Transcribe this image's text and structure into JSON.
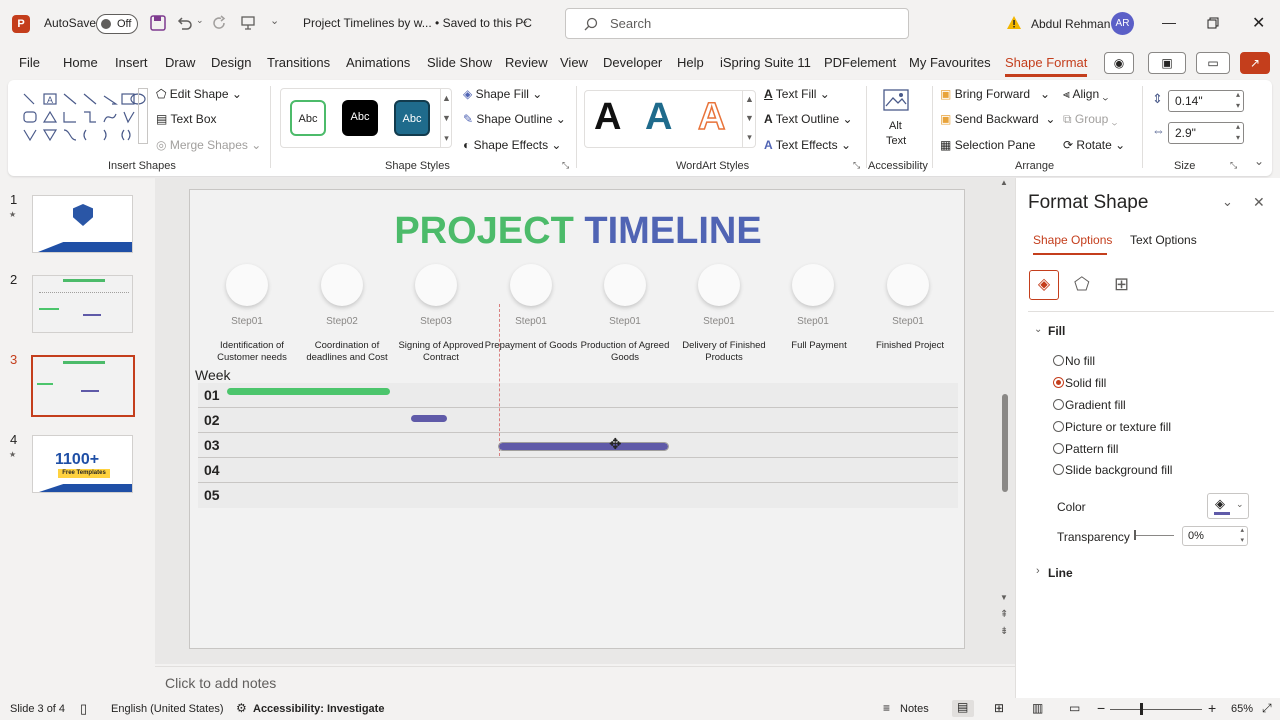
{
  "titlebar": {
    "autosave_label": "AutoSave",
    "autosave_state": "Off",
    "doc_title": "Project Timelines by w...  •  Saved to this PC",
    "search_placeholder": "Search",
    "user_name": "Abdul Rehman",
    "user_initials": "AR"
  },
  "menu": {
    "tabs": [
      "File",
      "Home",
      "Insert",
      "Draw",
      "Design",
      "Transitions",
      "Animations",
      "Slide Show",
      "Review",
      "View",
      "Developer",
      "Help",
      "iSpring Suite 11",
      "PDFelement",
      "My Favourites",
      "Shape Format"
    ],
    "active_tab": "Shape Format"
  },
  "ribbon": {
    "insert_shapes": {
      "label": "Insert Shapes",
      "edit_shape": "Edit Shape",
      "text_box": "Text Box",
      "merge_shapes": "Merge Shapes"
    },
    "shape_styles": {
      "label": "Shape Styles",
      "samples": [
        "Abc",
        "Abc",
        "Abc"
      ],
      "shape_fill": "Shape Fill",
      "shape_outline": "Shape Outline",
      "shape_effects": "Shape Effects"
    },
    "wordart": {
      "label": "WordArt Styles",
      "samples": [
        "A",
        "A",
        "A"
      ],
      "text_fill": "Text Fill",
      "text_outline": "Text Outline",
      "text_effects": "Text Effects"
    },
    "accessibility": {
      "label": "Accessibility",
      "alt_text_line1": "Alt",
      "alt_text_line2": "Text"
    },
    "arrange": {
      "label": "Arrange",
      "bring_forward": "Bring Forward",
      "send_backward": "Send Backward",
      "selection_pane": "Selection Pane",
      "align": "Align",
      "group": "Group",
      "rotate": "Rotate"
    },
    "size": {
      "label": "Size",
      "height": "0.14\"",
      "width": "2.9\""
    }
  },
  "thumbnails": [
    {
      "number": "1",
      "starred": true
    },
    {
      "number": "2",
      "starred": false
    },
    {
      "number": "3",
      "starred": false
    },
    {
      "number": "4",
      "starred": true
    }
  ],
  "thumb4_text": "1100+",
  "thumb4_sub": "Free Templates",
  "slide": {
    "title_part1": "PROJECT",
    "title_part2": "TIMELINE",
    "steps": [
      {
        "step": "Step01",
        "desc": "Identification of Customer needs"
      },
      {
        "step": "Step02",
        "desc": "Coordination of deadlines and Cost"
      },
      {
        "step": "Step03",
        "desc": "Signing of Approved Contract"
      },
      {
        "step": "Step01",
        "desc": "Prepayment of Goods"
      },
      {
        "step": "Step01",
        "desc": "Production of Agreed Goods"
      },
      {
        "step": "Step01",
        "desc": "Delivery of Finished Products"
      },
      {
        "step": "Step01",
        "desc": "Full Payment"
      },
      {
        "step": "Step01",
        "desc": "Finished Project"
      }
    ],
    "week_label": "Week",
    "weeks": [
      "01",
      "02",
      "03",
      "04",
      "05"
    ],
    "colors": {
      "green": "#4cbb6a",
      "blue": "#5064b4",
      "bar_green": "#4cc56c",
      "bar_purple": "#5f5aa8"
    }
  },
  "notes_placeholder": "Click to add notes",
  "format_pane": {
    "title": "Format Shape",
    "tab_shape": "Shape Options",
    "tab_text": "Text Options",
    "fill_header": "Fill",
    "fill_options": [
      "No fill",
      "Solid fill",
      "Gradient fill",
      "Picture or texture fill",
      "Pattern fill",
      "Slide background fill"
    ],
    "selected_fill": "Solid fill",
    "color_label": "Color",
    "transparency_label": "Transparency",
    "transparency_value": "0%",
    "line_header": "Line"
  },
  "status": {
    "slide_info": "Slide 3 of 4",
    "language": "English (United States)",
    "accessibility": "Accessibility: Investigate",
    "notes": "Notes",
    "zoom": "65%"
  }
}
